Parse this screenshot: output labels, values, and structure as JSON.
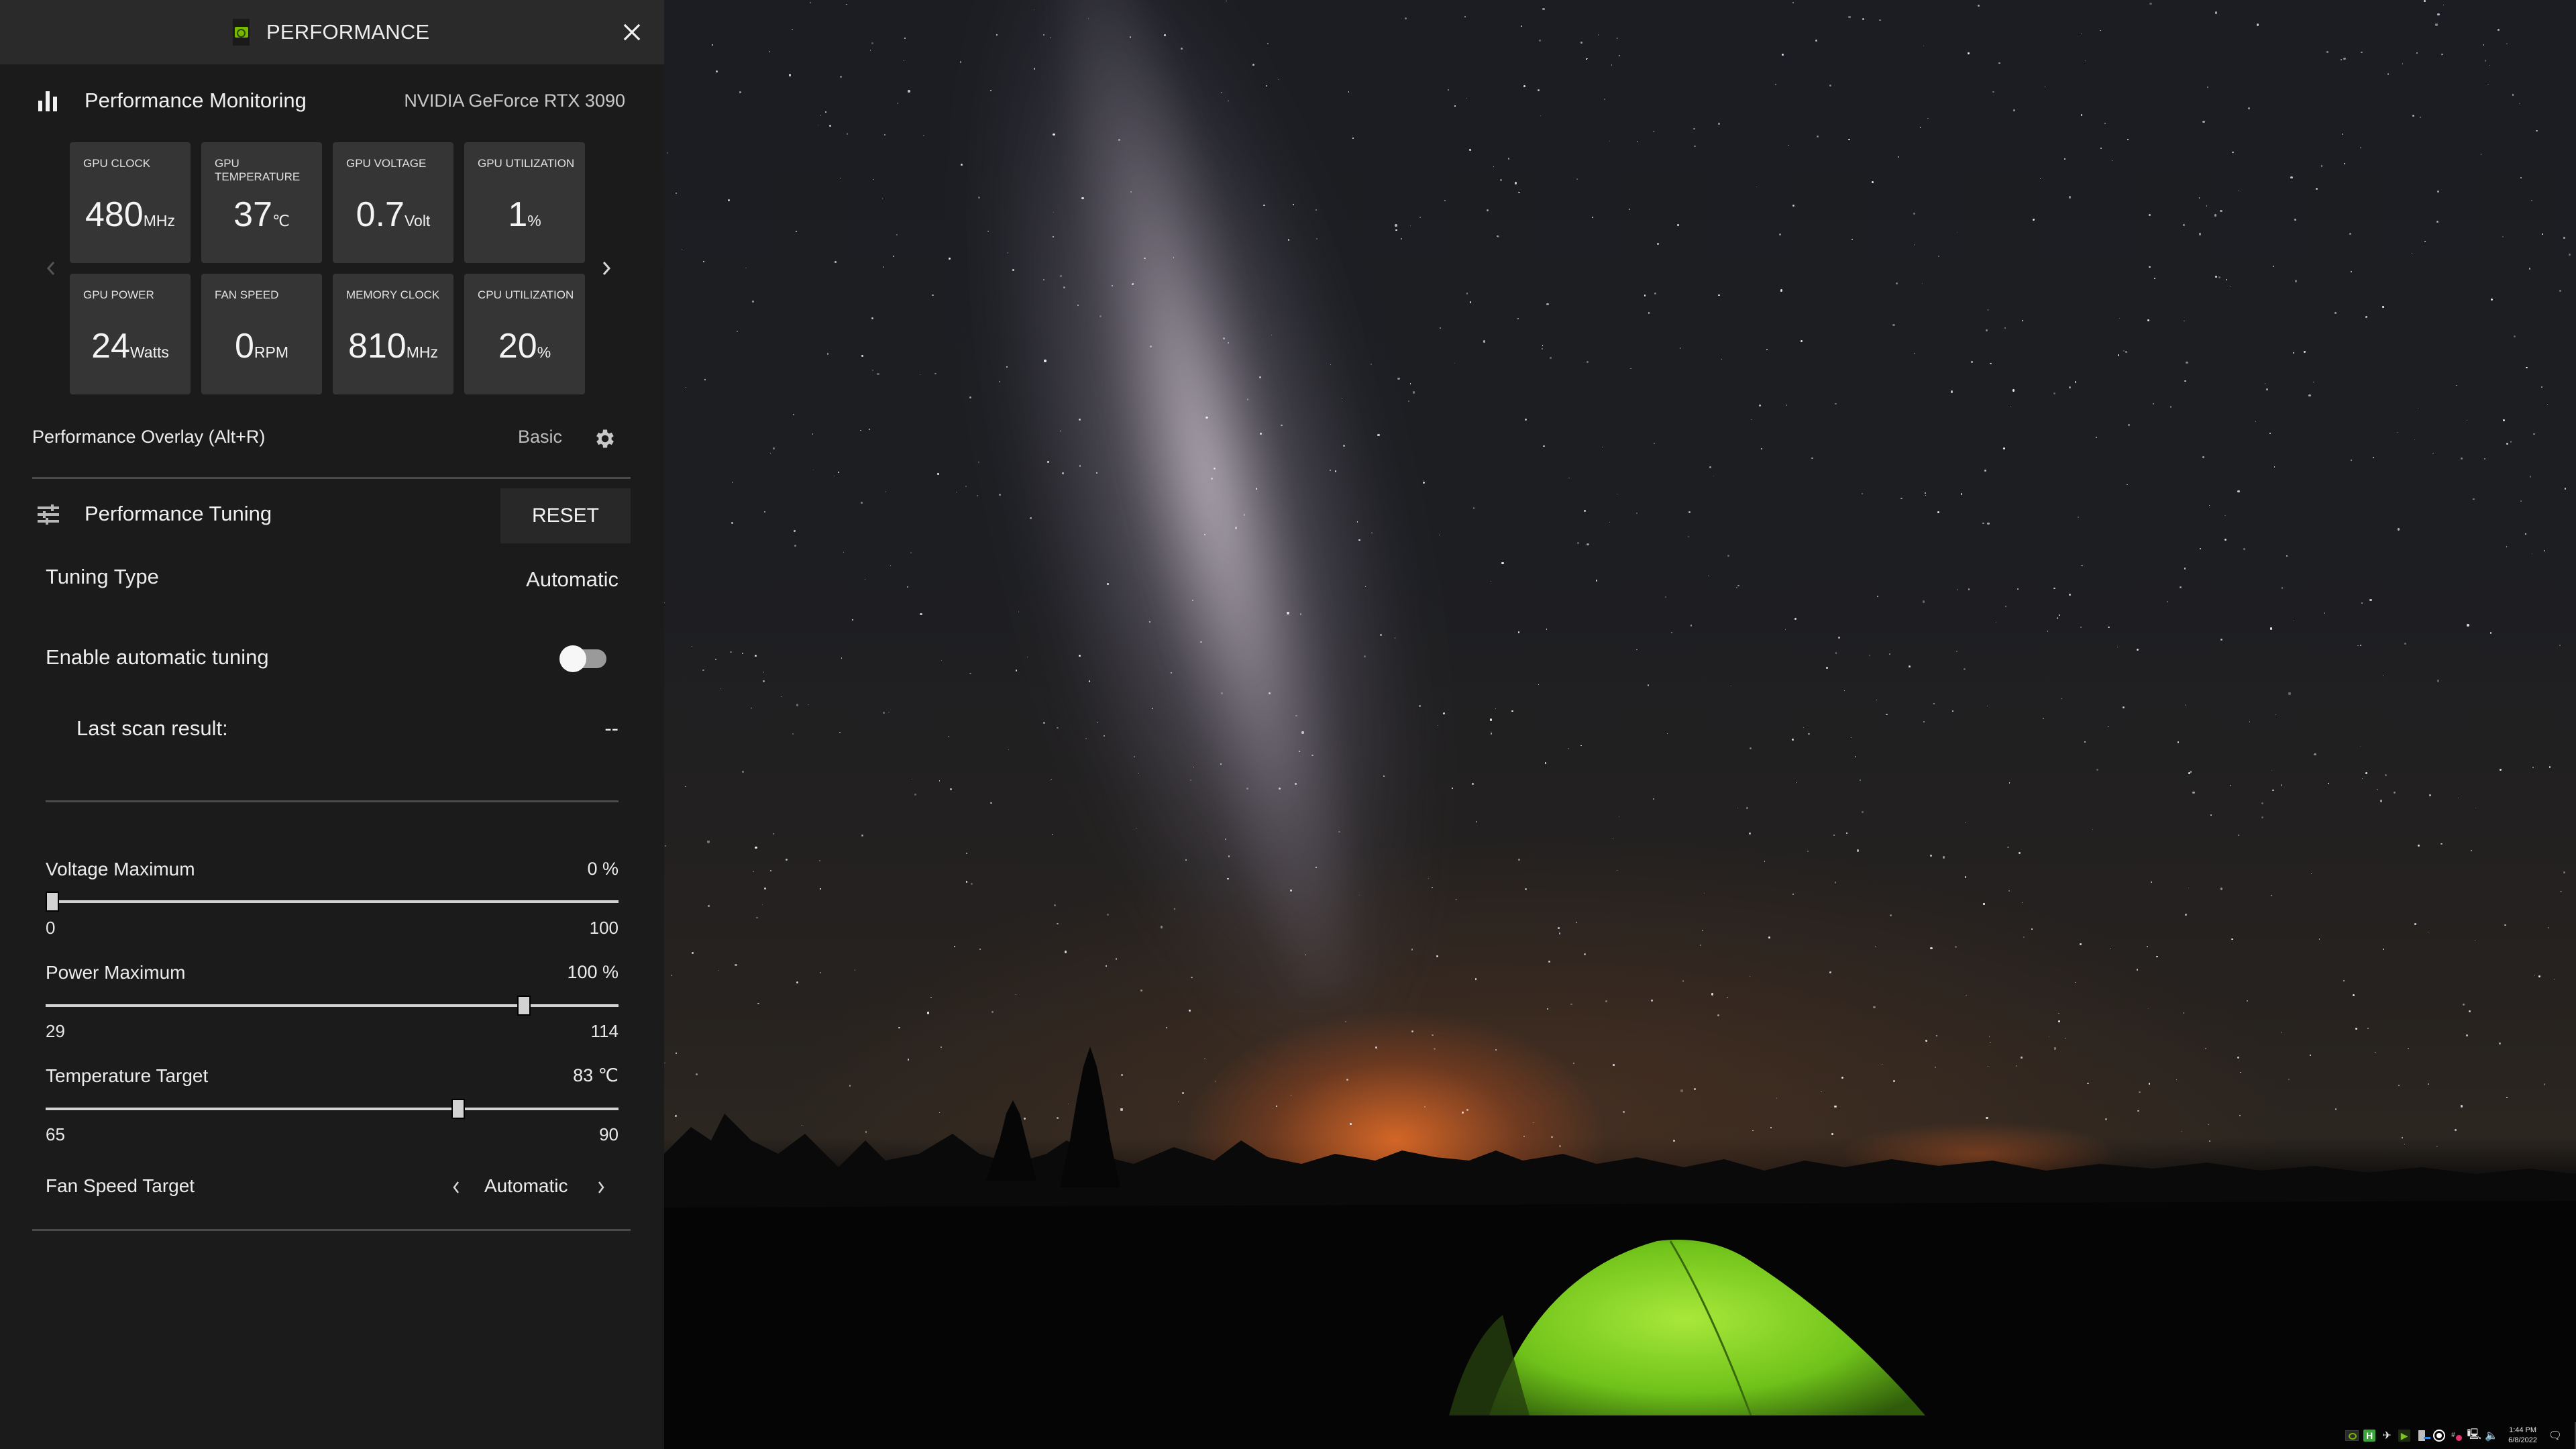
{
  "panel": {
    "title": "PERFORMANCE",
    "brand_color": "#76b900"
  },
  "monitoring": {
    "title": "Performance Monitoring",
    "gpu_name": "NVIDIA GeForce RTX 3090",
    "tiles": [
      {
        "label": "GPU CLOCK",
        "value": "480",
        "unit": "MHz"
      },
      {
        "label": "GPU TEMPERATURE",
        "value": "37",
        "unit": "℃"
      },
      {
        "label": "GPU VOLTAGE",
        "value": "0.7",
        "unit": "Volt"
      },
      {
        "label": "GPU UTILIZATION",
        "value": "1",
        "unit": "%"
      },
      {
        "label": "GPU POWER",
        "value": "24",
        "unit": "Watts"
      },
      {
        "label": "FAN SPEED",
        "value": "0",
        "unit": "RPM"
      },
      {
        "label": "MEMORY CLOCK",
        "value": "810",
        "unit": "MHz"
      },
      {
        "label": "CPU UTILIZATION",
        "value": "20",
        "unit": "%"
      }
    ]
  },
  "overlay": {
    "label": "Performance Overlay (Alt+R)",
    "mode": "Basic"
  },
  "tuning": {
    "title": "Performance Tuning",
    "reset_label": "RESET",
    "type_label": "Tuning Type",
    "type_value": "Automatic",
    "auto_label": "Enable automatic tuning",
    "auto_enabled": false,
    "last_scan_label": "Last scan result:",
    "last_scan_value": "--",
    "sliders": [
      {
        "label": "Voltage Maximum",
        "value": 0,
        "value_text": "0 %",
        "min": 0,
        "max": 100,
        "min_text": "0",
        "max_text": "100"
      },
      {
        "label": "Power Maximum",
        "value": 100,
        "value_text": "100 %",
        "min": 29,
        "max": 114,
        "min_text": "29",
        "max_text": "114"
      },
      {
        "label": "Temperature Target",
        "value": 83,
        "value_text": "83 ℃",
        "min": 65,
        "max": 90,
        "min_text": "65",
        "max_text": "90"
      }
    ],
    "fan_label": "Fan Speed Target",
    "fan_value": "Automatic"
  },
  "taskbar": {
    "tray_icons": [
      "nvidia-icon",
      "h-app-icon",
      "airplane-icon",
      "media-play-icon",
      "network-device-icon",
      "record-icon",
      "slack-icon",
      "network-icon",
      "volume-icon"
    ],
    "time": "1:44 PM",
    "date": "6/8/2022"
  }
}
